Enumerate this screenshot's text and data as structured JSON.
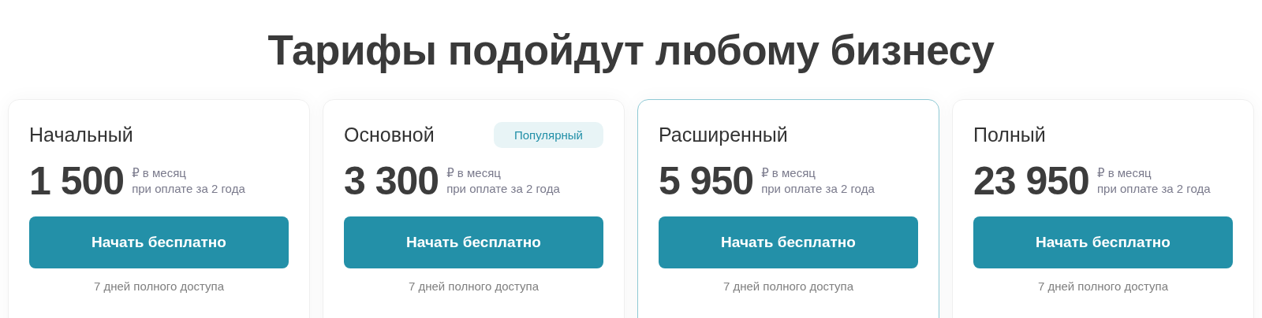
{
  "heading": "Тарифы подойдут любому бизнесу",
  "plans": [
    {
      "name": "Начальный",
      "price": "1 500",
      "period": "₽ в месяц",
      "billing": "при оплате за 2 года",
      "button": "Начать бесплатно",
      "note": "7 дней полного доступа",
      "selected": false
    },
    {
      "name": "Основной",
      "badge": "Популярный",
      "price": "3 300",
      "period": "₽ в месяц",
      "billing": "при оплате за 2 года",
      "button": "Начать бесплатно",
      "note": "7 дней полного доступа",
      "selected": false
    },
    {
      "name": "Расширенный",
      "price": "5 950",
      "period": "₽ в месяц",
      "billing": "при оплате за 2 года",
      "button": "Начать бесплатно",
      "note": "7 дней полного доступа",
      "selected": true
    },
    {
      "name": "Полный",
      "price": "23 950",
      "period": "₽ в месяц",
      "billing": "при оплате за 2 года",
      "button": "Начать бесплатно",
      "note": "7 дней полного доступа",
      "selected": false
    }
  ]
}
